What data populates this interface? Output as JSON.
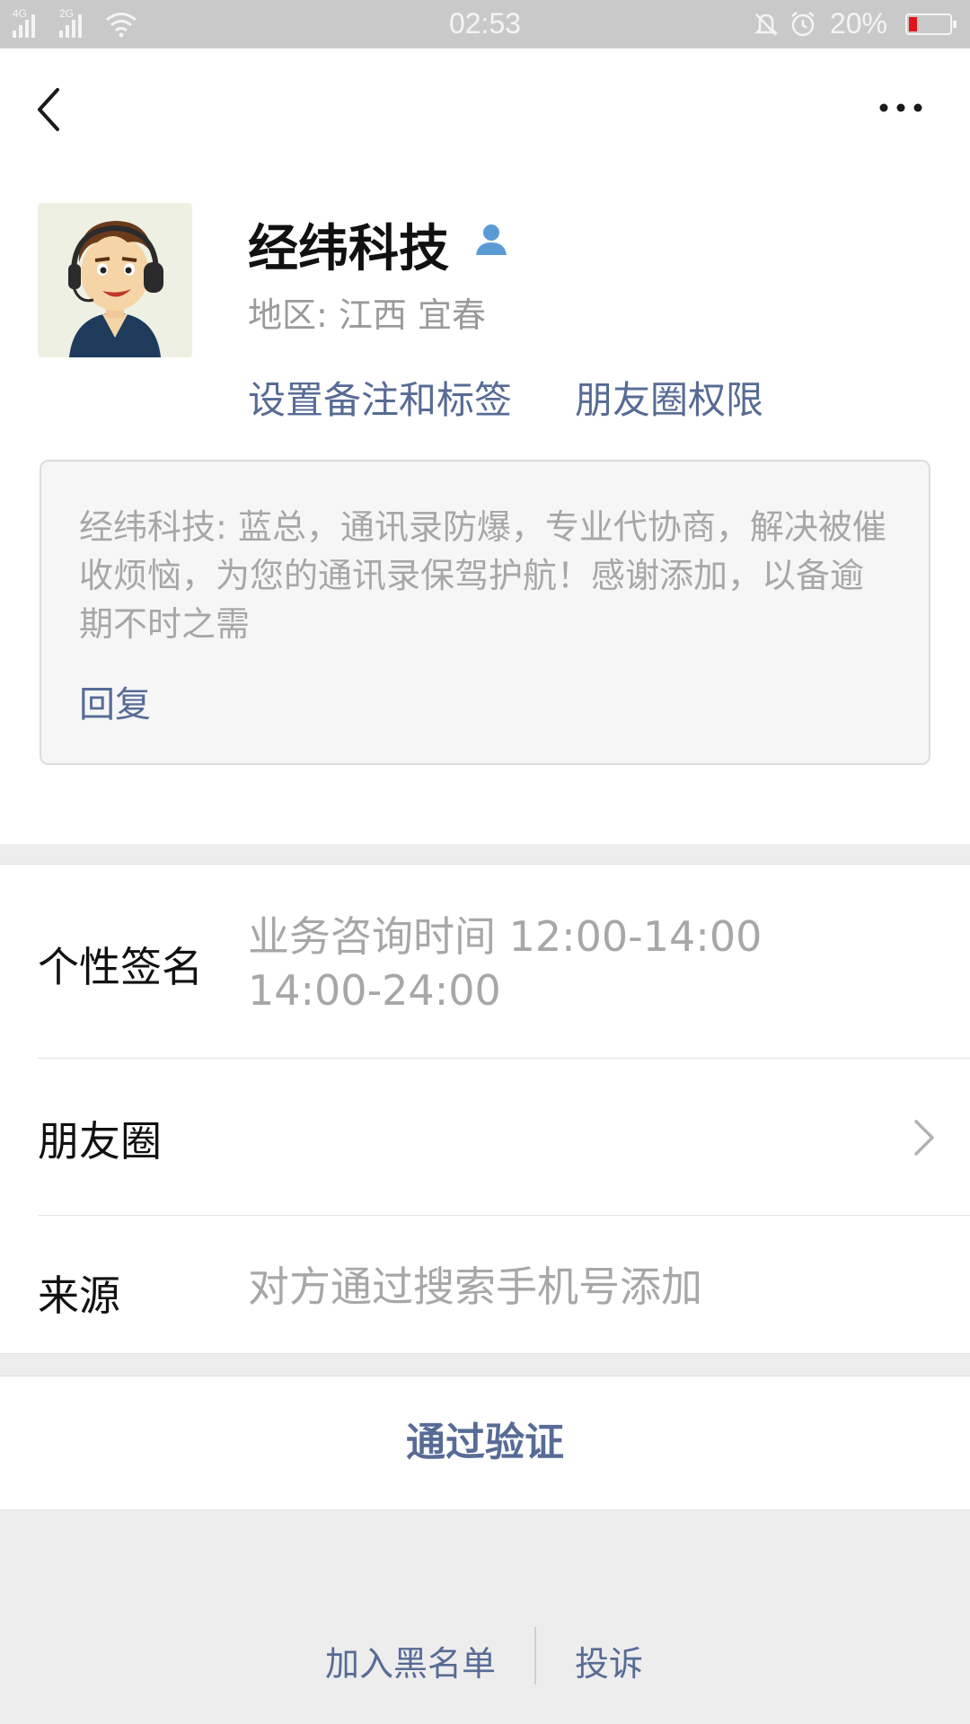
{
  "status_bar": {
    "network_1": "4G",
    "network_2": "2G",
    "time": "02:53",
    "battery": "20%",
    "battery_level": 0.2,
    "icons": [
      "signal-4g-icon",
      "signal-2g-icon",
      "wifi-icon",
      "bell-muted-icon",
      "alarm-icon",
      "battery-icon"
    ]
  },
  "nav": {
    "back_icon": "chevron-left-icon",
    "more_icon": "more-dots-icon"
  },
  "profile": {
    "name": "经纬科技",
    "region": "地区:  江西  宜春",
    "set_remark_label": "设置备注和标签",
    "moments_permission_label": "朋友圈权限"
  },
  "message": {
    "text": "经纬科技: 蓝总，通讯录防爆，专业代协商，解决被催收烦恼，为您的通讯录保驾护航！感谢添加，以备逾期不时之需",
    "reply_label": "回复"
  },
  "info": {
    "signature_label": "个性签名",
    "signature_line1": "业务咨询时间  12:00-14:00",
    "signature_line2": "14:00-24:00",
    "moments_label": "朋友圈",
    "source_label": "来源",
    "source_value": "对方通过搜索手机号添加"
  },
  "actions": {
    "verify_label": "通过验证",
    "blacklist_label": "加入黑名单",
    "complain_label": "投诉"
  },
  "colors": {
    "link": "#576b95",
    "status_bar": "#c9c9c9",
    "battery_low": "#e1141a",
    "background": "#ededed"
  }
}
